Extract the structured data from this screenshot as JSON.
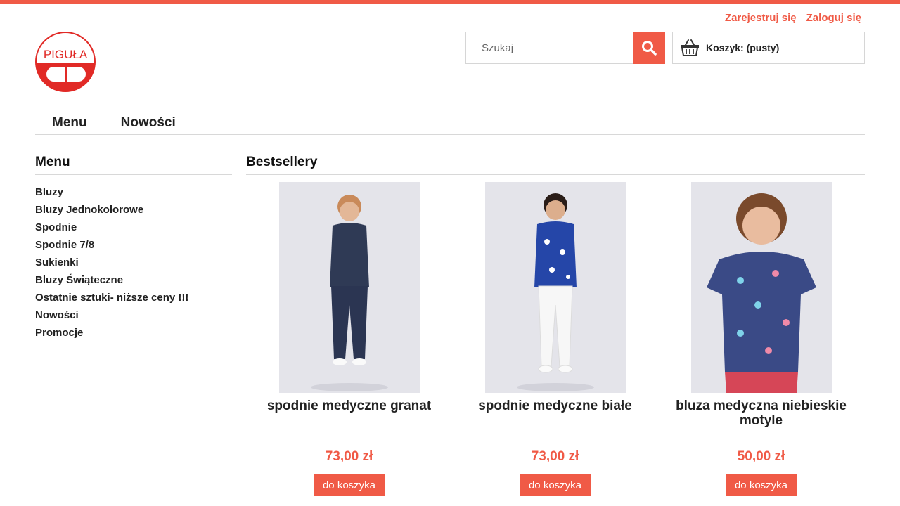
{
  "colors": {
    "accent": "#f05a46",
    "border": "#d8d8d8",
    "text": "#222222"
  },
  "header": {
    "register": "Zarejestruj się",
    "login": "Zaloguj się",
    "logo_text": "PIGUŁA",
    "search": {
      "placeholder": "Szukaj",
      "value": "",
      "icon": "search-icon"
    },
    "cart": {
      "label": "Koszyk: (pusty)",
      "icon": "basket-icon"
    }
  },
  "nav": [
    {
      "label": "Menu"
    },
    {
      "label": "Nowości"
    }
  ],
  "sidebar": {
    "title": "Menu",
    "items": [
      {
        "label": "Bluzy"
      },
      {
        "label": "Bluzy Jednokolorowe"
      },
      {
        "label": "Spodnie"
      },
      {
        "label": "Spodnie 7/8"
      },
      {
        "label": "Sukienki"
      },
      {
        "label": "Bluzy Świąteczne"
      },
      {
        "label": "Ostatnie sztuki- niższe ceny !!!"
      },
      {
        "label": "Nowości"
      },
      {
        "label": "Promocje"
      }
    ]
  },
  "main": {
    "title": "Bestsellery",
    "products": [
      {
        "name": "spodnie medyczne granat",
        "price": "73,00 zł",
        "button": "do koszyka",
        "top_color": "#2f3a55",
        "bottom_color": "#2b3552"
      },
      {
        "name": "spodnie medyczne białe",
        "price": "73,00 zł",
        "button": "do koszyka",
        "top_color": "#2546a8",
        "bottom_color": "#f7f7f7"
      },
      {
        "name": "bluza medyczna niebieskie motyle",
        "price": "50,00 zł",
        "button": "do koszyka",
        "top_color": "#3a4a86",
        "bottom_color": "#d64657"
      }
    ]
  }
}
